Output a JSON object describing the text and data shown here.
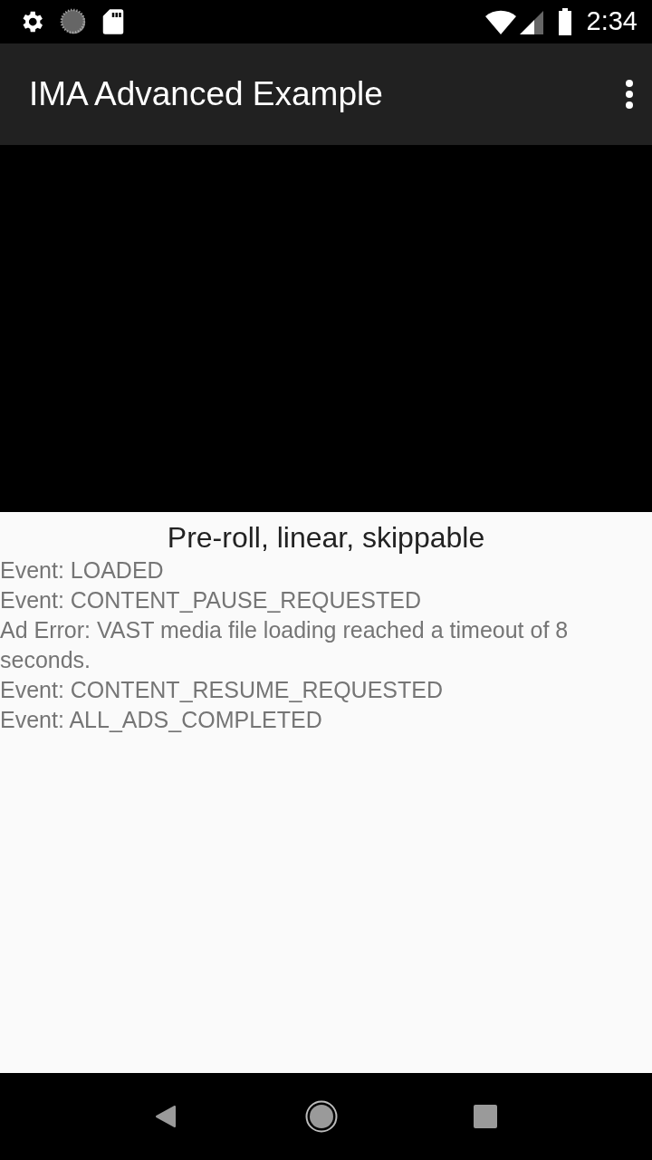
{
  "status_bar": {
    "time": "2:34"
  },
  "app_bar": {
    "title": "IMA Advanced Example"
  },
  "video": {
    "kind": "player"
  },
  "caption": "Pre-roll, linear, skippable",
  "log": [
    "Event: LOADED",
    "Event: CONTENT_PAUSE_REQUESTED",
    "Ad Error: VAST media file loading reached a timeout of 8 seconds.",
    "Event: CONTENT_RESUME_REQUESTED",
    "Event: ALL_ADS_COMPLETED"
  ]
}
